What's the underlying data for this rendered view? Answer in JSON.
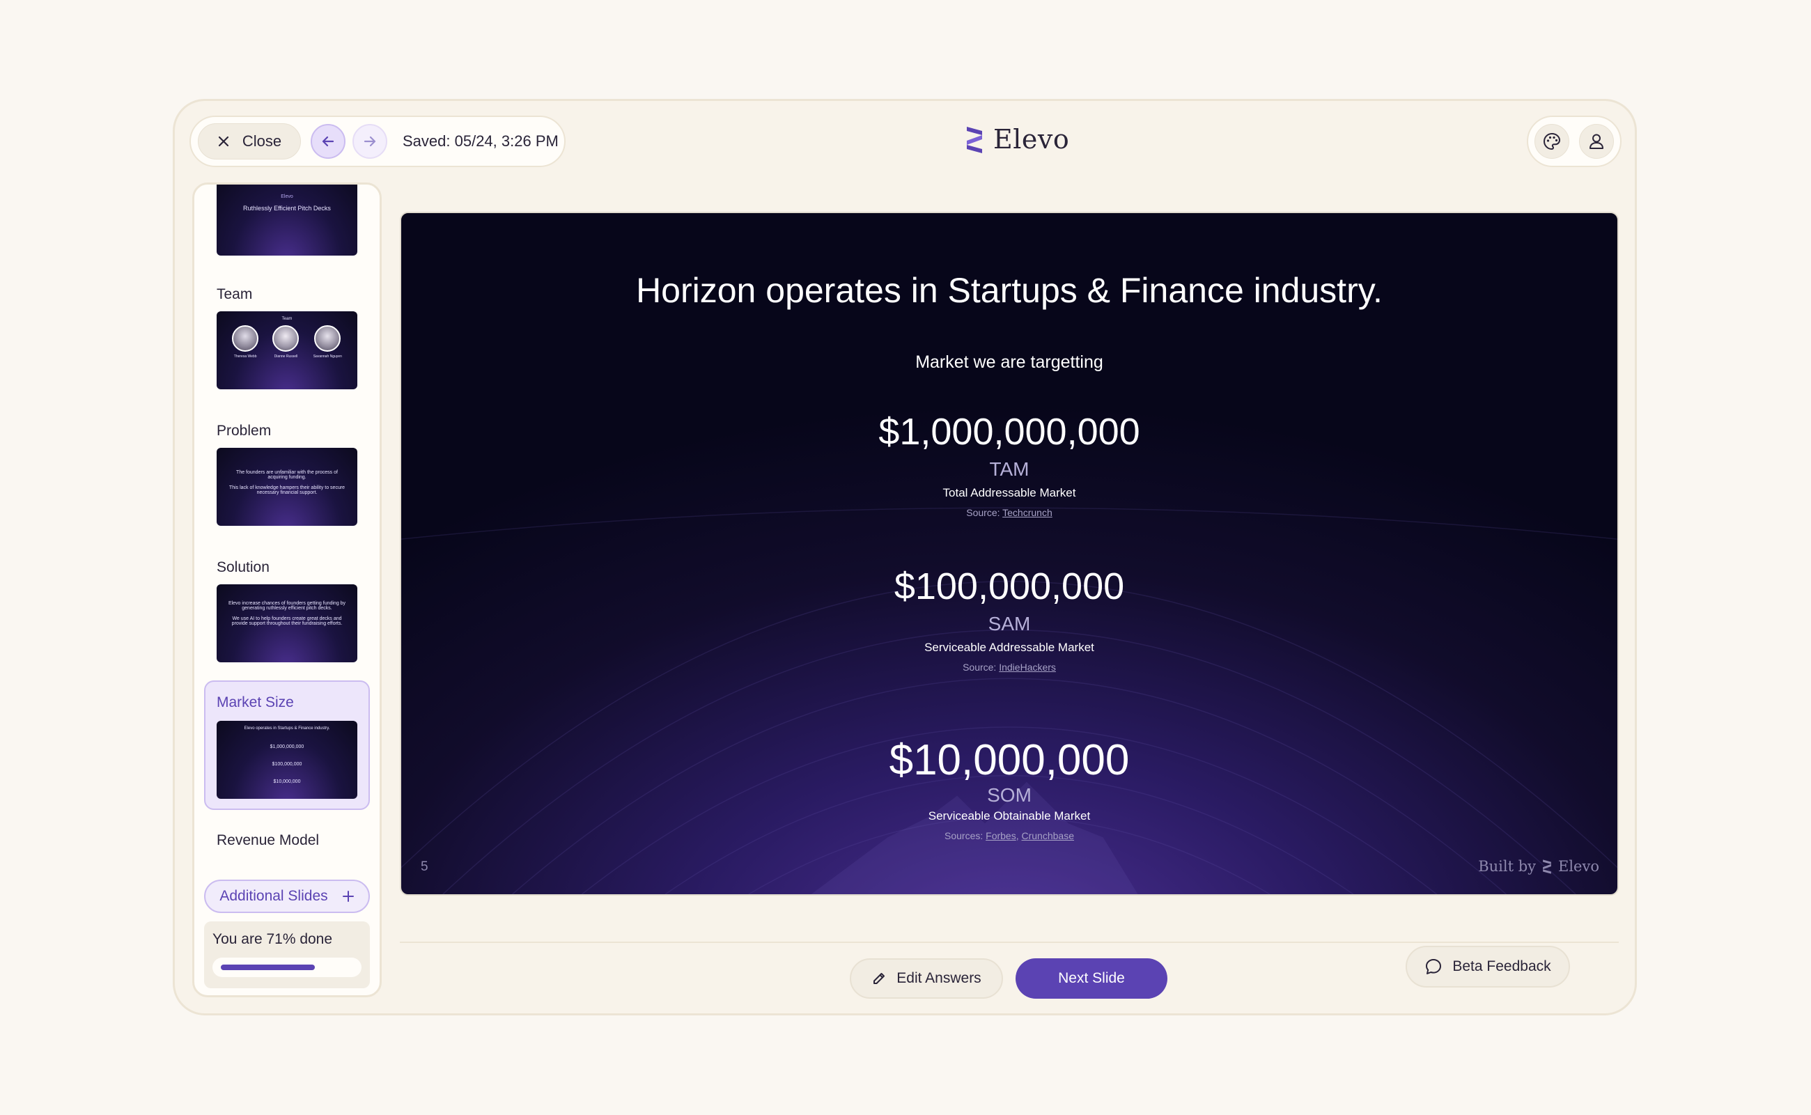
{
  "toolbar": {
    "close_label": "Close",
    "saved_text": "Saved: 05/24, 3:26 PM"
  },
  "logo": {
    "text": "Elevo"
  },
  "sidebar": {
    "items": [
      {
        "label": "",
        "thumb_text": "Ruthlessly Efficient Pitch Decks",
        "thumb_brand": "Elevo"
      },
      {
        "label": "Team",
        "thumb_title": "Team",
        "members": [
          "Theresa Webb",
          "Dianne Russell",
          "Savannah Nguyen"
        ]
      },
      {
        "label": "Problem",
        "thumb_text": "The founders are unfamiliar with the process of acquiring funding.",
        "thumb_text2": "This lack of knowledge hampers their ability to secure necessary financial support."
      },
      {
        "label": "Solution",
        "thumb_text": "Elevo increase chances of founders getting funding by generating ruthlessly efficient pitch decks.",
        "thumb_text2": "We use AI to help founders create great decks and provide support throughout their fundraising efforts."
      },
      {
        "label": "Market Size",
        "thumb_text": "Elevo operates in Startups & Finance industry.",
        "thumb_amounts": [
          "$1,000,000,000",
          "$100,000,000",
          "$10,000,000"
        ]
      },
      {
        "label": "Revenue Model"
      }
    ],
    "additional_slides_label": "Additional Slides",
    "progress_text": "You are 71% done",
    "progress_value": 0.71
  },
  "slide": {
    "title": "Horizon operates in Startups & Finance industry.",
    "subtitle": "Market we are targetting",
    "metrics": [
      {
        "amount": "$1,000,000,000",
        "abbr": "TAM",
        "full": "Total Addressable Market",
        "source_prefix": "Source: ",
        "source_links": [
          "Techcrunch"
        ]
      },
      {
        "amount": "$100,000,000",
        "abbr": "SAM",
        "full": "Serviceable Addressable Market",
        "source_prefix": "Source: ",
        "source_links": [
          "IndieHackers"
        ]
      },
      {
        "amount": "$10,000,000",
        "abbr": "SOM",
        "full": "Serviceable Obtainable Market",
        "source_prefix": "Sources: ",
        "source_links": [
          "Forbes",
          "Crunchbase"
        ]
      }
    ],
    "page_number": "5",
    "built_by": "Built by",
    "built_brand": "Elevo"
  },
  "actions": {
    "edit_label": "Edit Answers",
    "next_label": "Next Slide",
    "beta_label": "Beta Feedback"
  },
  "colors": {
    "accent": "#5b43b3",
    "accent_light": "#ede6fb",
    "background": "#faf7f2"
  }
}
